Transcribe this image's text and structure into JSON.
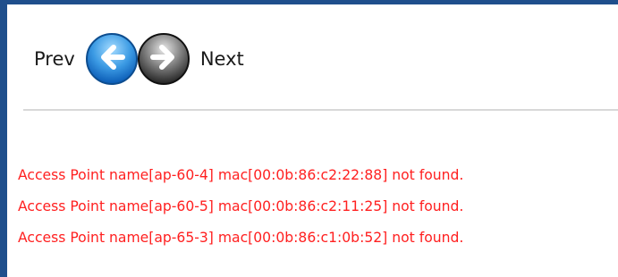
{
  "nav": {
    "prev_label": "Prev",
    "next_label": "Next",
    "prev_icon": "back-arrow-icon",
    "next_icon": "forward-arrow-icon"
  },
  "messages": [
    "Access Point name[ap-60-4] mac[00:0b:86:c2:22:88] not found.",
    "Access Point name[ap-60-5] mac[00:0b:86:c2:11:25] not found.",
    "Access Point name[ap-65-3] mac[00:0b:86:c1:0b:52] not found."
  ],
  "colors": {
    "border": "#1f4f8c",
    "error_text": "#ff2020",
    "divider": "#d8d8d8"
  }
}
